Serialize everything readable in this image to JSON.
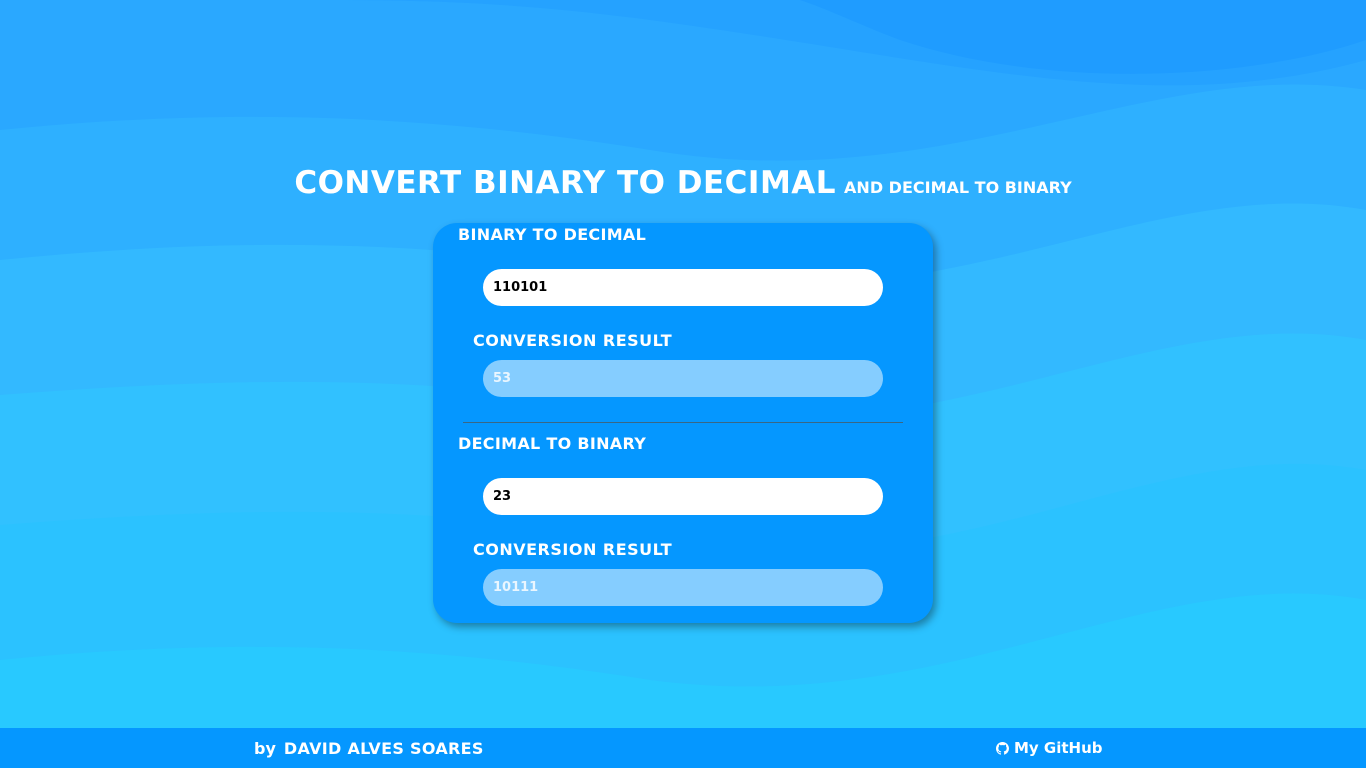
{
  "header": {
    "title": "CONVERT BINARY TO DECIMAL",
    "subtitle": "AND DECIMAL TO BINARY"
  },
  "binary_to_decimal": {
    "title": "BINARY TO DECIMAL",
    "input_value": "110101",
    "result_label": "CONVERSION RESULT",
    "result_value": "53"
  },
  "decimal_to_binary": {
    "title": "DECIMAL TO BINARY",
    "input_value": "23",
    "result_label": "CONVERSION RESULT",
    "result_value": "10111"
  },
  "footer": {
    "by_label": "by",
    "author": "DAVID ALVES SOARES",
    "github_label": "My GitHub",
    "github_icon": "github-icon"
  },
  "colors": {
    "card_background": "#0597ff",
    "footer_background": "#0597ff",
    "result_field": "#85cdff",
    "input_field": "#ffffff",
    "text": "#ffffff"
  }
}
